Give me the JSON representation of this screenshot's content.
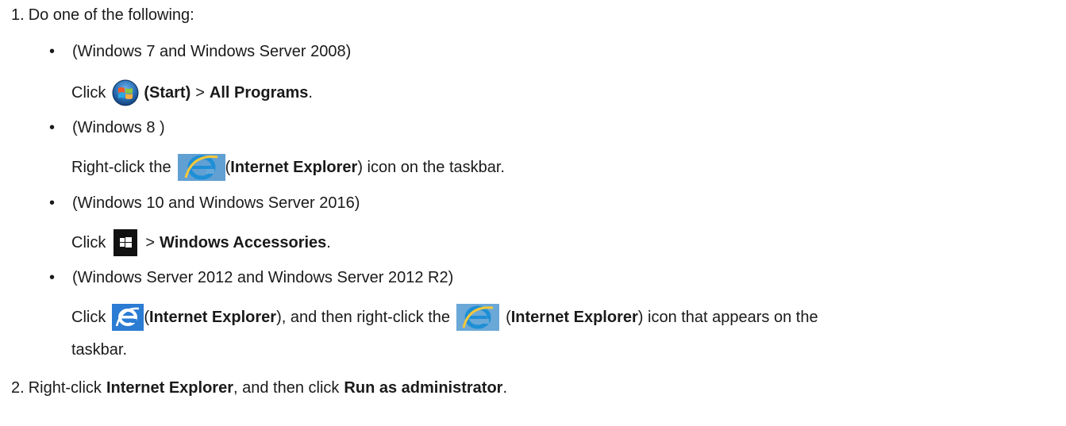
{
  "step1": {
    "number": "1.",
    "text": "Do one of the following:",
    "options": [
      {
        "bullet": "•",
        "heading": "(Windows 7 and Windows Server 2008)",
        "click": "Click",
        "start_label": "(Start)",
        "sep": ">",
        "target": "All Programs",
        "end": ".",
        "icon": "windows-7-start-orb-icon"
      },
      {
        "bullet": "•",
        "heading": "(Windows 8 )",
        "pre": "Right-click the",
        "open_paren": "(",
        "target": "Internet Explorer",
        "post": ") icon on the taskbar.",
        "icon": "internet-explorer-icon"
      },
      {
        "bullet": "•",
        "heading": "(Windows 10 and Windows Server 2016)",
        "click": "Click",
        "sep": ">",
        "target": "Windows Accessories",
        "end": ".",
        "icon": "windows-10-start-icon"
      },
      {
        "bullet": "•",
        "heading": "(Windows Server 2012 and Windows Server 2012 R2)",
        "click": "Click",
        "open_paren": "(",
        "target": "Internet Explorer",
        "mid": "), and then right-click the",
        "open_paren2": "(",
        "target2": "Internet Explorer",
        "post": ") icon that appears on the",
        "continuation": "taskbar.",
        "icon": "internet-explorer-tile-icon",
        "icon2": "internet-explorer-icon"
      }
    ]
  },
  "step2": {
    "number": "2.",
    "pre": "Right-click",
    "target": "Internet Explorer",
    "mid": ", and then click",
    "target2": "Run as administrator",
    "end": "."
  },
  "colors": {
    "text": "#1a1a1a",
    "ie_blue": "#1e8fd6",
    "ie_tile_bg": "#2b7cd3",
    "win10_bg": "#111111",
    "win7_orb": "#2a6fb5"
  }
}
